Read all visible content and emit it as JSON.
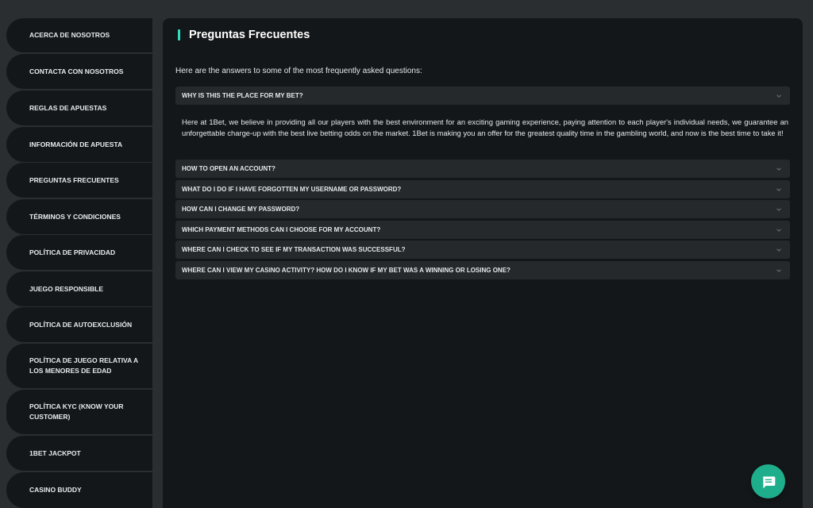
{
  "sidebar": {
    "items": [
      {
        "label": "ACERCA DE NOSOTROS"
      },
      {
        "label": "CONTACTA CON NOSOTROS"
      },
      {
        "label": "REGLAS DE APUESTAS"
      },
      {
        "label": "INFORMACIÓN DE APUESTA"
      },
      {
        "label": "PREGUNTAS FRECUENTES"
      },
      {
        "label": "TÉRMINOS Y CONDICIONES"
      },
      {
        "label": "POLÍTICA DE PRIVACIDAD"
      },
      {
        "label": "JUEGO RESPONSIBLE"
      },
      {
        "label": "POLÍTICA DE AUTOEXCLUSIÓN"
      },
      {
        "label": "POLÍTICA DE JUEGO RELATIVA A LOS MENORES DE EDAD"
      },
      {
        "label": "POLÍTICA KYC (KNOW YOUR CUSTOMER)"
      },
      {
        "label": "1BET JACKPOT"
      },
      {
        "label": "CASINO BUDDY"
      }
    ],
    "active_label": "PREGUNTAS FRECUENTES"
  },
  "main": {
    "title": "Preguntas Frecuentes",
    "intro": "Here are the answers to some of the most frequently asked questions:",
    "faqs": [
      {
        "question": "WHY IS THIS THE PLACE FOR MY BET?",
        "expanded": true,
        "answer": "Here at 1Bet, we believe in providing all our players with the best environment for an exciting gaming experience, paying attention to each player's individual needs, we guarantee an unforgettable charge-up with the best live betting odds on the market. 1Bet is making you an offer for the greatest quality time in the gambling world, and now is the best time to take it!"
      },
      {
        "question": "HOW TO OPEN AN ACCOUNT?",
        "expanded": false
      },
      {
        "question": "WHAT DO I DO IF I HAVE FORGOTTEN MY USERNAME OR PASSWORD?",
        "expanded": false
      },
      {
        "question": "HOW CAN I CHANGE MY PASSWORD?",
        "expanded": false
      },
      {
        "question": "WHICH PAYMENT METHODS CAN I CHOOSE FOR MY ACCOUNT?",
        "expanded": false
      },
      {
        "question": "WHERE CAN I CHECK TO SEE IF MY TRANSACTION WAS SUCCESSFUL?",
        "expanded": false
      },
      {
        "question": "WHERE CAN I VIEW MY CASINO ACTIVITY? HOW DO I KNOW IF MY BET WAS A WINNING OR LOSING ONE?",
        "expanded": false
      }
    ]
  },
  "chat_button": {
    "icon": "chat-bubble-icon"
  },
  "colors": {
    "background": "#2b2e30",
    "panel": "#141719",
    "faq_row": "#25292b",
    "accent": "#2fe0c0",
    "chat": "#1fae8c"
  }
}
